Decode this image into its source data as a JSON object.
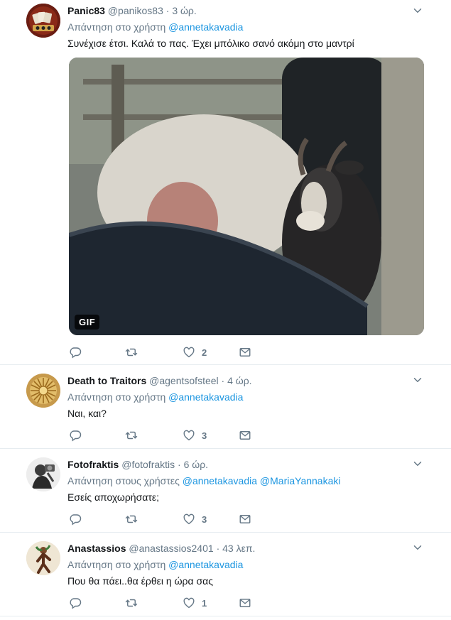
{
  "tweets": [
    {
      "name": "Panic83",
      "handle": "@panikos83",
      "sep": "·",
      "time": "3 ώρ.",
      "reply_prefix": "Απάντηση στο χρήστη",
      "mentions": [
        "@annetakavadia"
      ],
      "text": "Συνέχισε έτσι.  Καλά το πας.  Έχει μπόλικο σανό ακόμη στο μαντρί",
      "media_badge": "GIF",
      "likes": "2"
    },
    {
      "name": "Death to Traitors",
      "handle": "@agentsofsteel",
      "sep": "·",
      "time": "4 ώρ.",
      "reply_prefix": "Απάντηση στο χρήστη",
      "mentions": [
        "@annetakavadia"
      ],
      "text": "Ναι, και?",
      "likes": "3"
    },
    {
      "name": "Fotofraktis",
      "handle": "@fotofraktis",
      "sep": "·",
      "time": "6 ώρ.",
      "reply_prefix": "Απάντηση στους χρήστες",
      "mentions": [
        "@annetakavadia",
        "@MariaYannakaki"
      ],
      "text": "Εσείς αποχωρήσατε;",
      "likes": "3"
    },
    {
      "name": "Anastassios",
      "handle": "@anastassios2401",
      "sep": "·",
      "time": "43 λεπ.",
      "reply_prefix": "Απάντηση στο χρήστη",
      "mentions": [
        "@annetakavadia"
      ],
      "text": "Που θα πάει..θα έρθει η ώρα σας",
      "likes": "1"
    }
  ],
  "colors": {
    "link": "#1b95e0",
    "muted": "#657786",
    "divider": "#e6ecf0"
  },
  "icons": [
    "reply-icon",
    "retweet-icon",
    "heart-icon",
    "direct-message-icon",
    "chevron-down-icon"
  ]
}
